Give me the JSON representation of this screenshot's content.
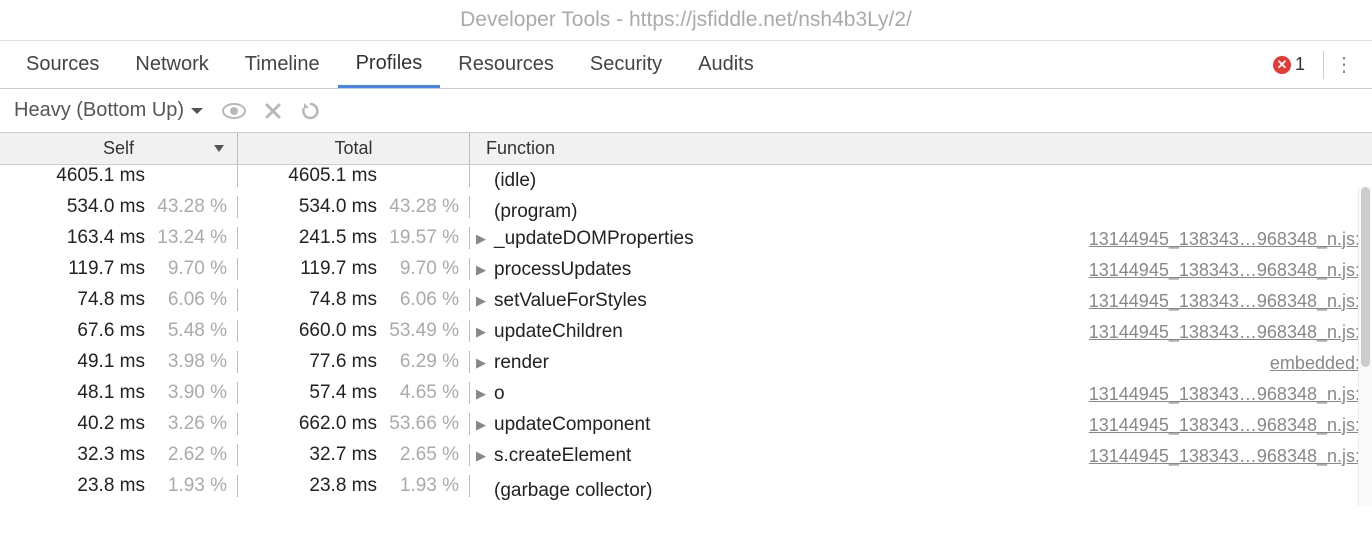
{
  "window_title": "Developer Tools - https://jsfiddle.net/nsh4b3Ly/2/",
  "tabs": {
    "sources": "Sources",
    "network": "Network",
    "timeline": "Timeline",
    "profiles": "Profiles",
    "resources": "Resources",
    "security": "Security",
    "audits": "Audits",
    "active": "profiles"
  },
  "error_count": "1",
  "toolbar": {
    "view_mode": "Heavy (Bottom Up)"
  },
  "headers": {
    "self": "Self",
    "total": "Total",
    "function": "Function"
  },
  "rows": [
    {
      "self_ms": "4605.1 ms",
      "self_pct": "",
      "total_ms": "4605.1 ms",
      "total_pct": "",
      "expandable": false,
      "func": "(idle)",
      "link": ""
    },
    {
      "self_ms": "534.0 ms",
      "self_pct": "43.28 %",
      "total_ms": "534.0 ms",
      "total_pct": "43.28 %",
      "expandable": false,
      "func": "(program)",
      "link": ""
    },
    {
      "self_ms": "163.4 ms",
      "self_pct": "13.24 %",
      "total_ms": "241.5 ms",
      "total_pct": "19.57 %",
      "expandable": true,
      "func": "_updateDOMProperties",
      "link": "13144945_138343…968348_n.js:"
    },
    {
      "self_ms": "119.7 ms",
      "self_pct": "9.70 %",
      "total_ms": "119.7 ms",
      "total_pct": "9.70 %",
      "expandable": true,
      "func": "processUpdates",
      "link": "13144945_138343…968348_n.js:"
    },
    {
      "self_ms": "74.8 ms",
      "self_pct": "6.06 %",
      "total_ms": "74.8 ms",
      "total_pct": "6.06 %",
      "expandable": true,
      "func": "setValueForStyles",
      "link": "13144945_138343…968348_n.js:"
    },
    {
      "self_ms": "67.6 ms",
      "self_pct": "5.48 %",
      "total_ms": "660.0 ms",
      "total_pct": "53.49 %",
      "expandable": true,
      "func": "updateChildren",
      "link": "13144945_138343…968348_n.js:"
    },
    {
      "self_ms": "49.1 ms",
      "self_pct": "3.98 %",
      "total_ms": "77.6 ms",
      "total_pct": "6.29 %",
      "expandable": true,
      "func": "render",
      "link": "embedded:"
    },
    {
      "self_ms": "48.1 ms",
      "self_pct": "3.90 %",
      "total_ms": "57.4 ms",
      "total_pct": "4.65 %",
      "expandable": true,
      "func": "o",
      "link": "13144945_138343…968348_n.js:"
    },
    {
      "self_ms": "40.2 ms",
      "self_pct": "3.26 %",
      "total_ms": "662.0 ms",
      "total_pct": "53.66 %",
      "expandable": true,
      "func": "updateComponent",
      "link": "13144945_138343…968348_n.js:"
    },
    {
      "self_ms": "32.3 ms",
      "self_pct": "2.62 %",
      "total_ms": "32.7 ms",
      "total_pct": "2.65 %",
      "expandable": true,
      "func": "s.createElement",
      "link": "13144945_138343…968348_n.js:"
    },
    {
      "self_ms": "23.8 ms",
      "self_pct": "1.93 %",
      "total_ms": "23.8 ms",
      "total_pct": "1.93 %",
      "expandable": false,
      "func": "(garbage collector)",
      "link": ""
    }
  ]
}
